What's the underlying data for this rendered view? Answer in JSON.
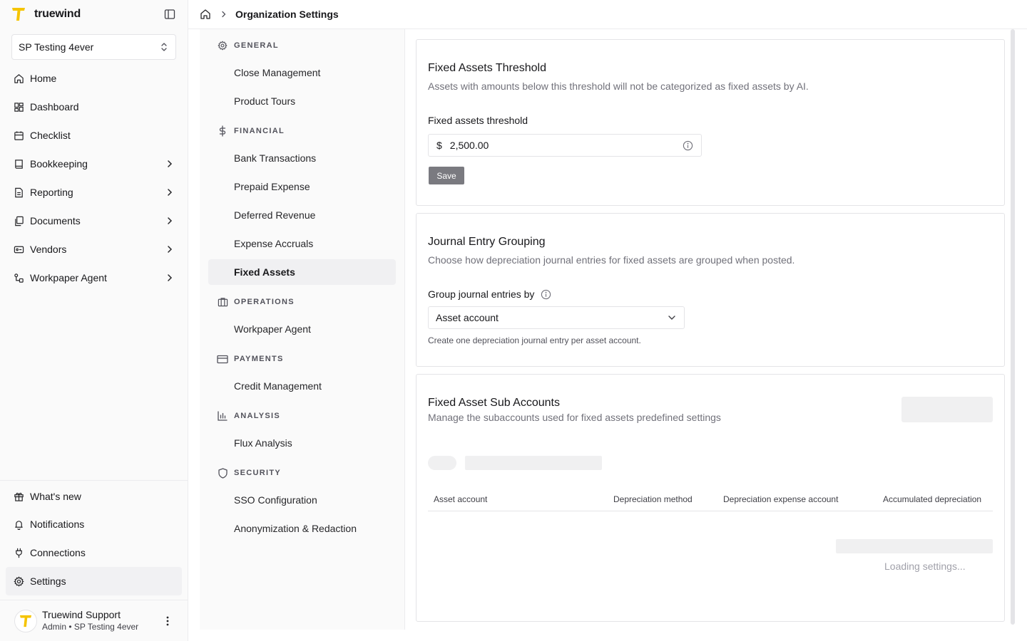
{
  "app": {
    "name": "truewind"
  },
  "org_switcher": {
    "name": "SP Testing 4ever"
  },
  "sidebar": {
    "items": [
      {
        "label": "Home",
        "icon": "home-icon"
      },
      {
        "label": "Dashboard",
        "icon": "dashboard-icon"
      },
      {
        "label": "Checklist",
        "icon": "calendar-icon"
      },
      {
        "label": "Bookkeeping",
        "icon": "book-icon",
        "has_children": true
      },
      {
        "label": "Reporting",
        "icon": "file-text-icon",
        "has_children": true
      },
      {
        "label": "Documents",
        "icon": "documents-icon",
        "has_children": true
      },
      {
        "label": "Vendors",
        "icon": "vendor-card-icon",
        "has_children": true
      },
      {
        "label": "Workpaper Agent",
        "icon": "agent-icon",
        "has_children": true
      }
    ],
    "bottom": [
      {
        "label": "What's new",
        "icon": "gift-icon"
      },
      {
        "label": "Notifications",
        "icon": "bell-icon"
      },
      {
        "label": "Connections",
        "icon": "plug-icon"
      },
      {
        "label": "Settings",
        "icon": "gear-icon",
        "active": true
      }
    ]
  },
  "user": {
    "name": "Truewind Support",
    "role": "Admin • SP Testing 4ever"
  },
  "breadcrumb": {
    "current": "Organization Settings"
  },
  "settings_nav": {
    "general": {
      "label": "GENERAL",
      "items": [
        "Close Management",
        "Product Tours"
      ]
    },
    "financial": {
      "label": "FINANCIAL",
      "items": [
        "Bank Transactions",
        "Prepaid Expense",
        "Deferred Revenue",
        "Expense Accruals",
        "Fixed Assets"
      ]
    },
    "operations": {
      "label": "OPERATIONS",
      "items": [
        "Workpaper Agent"
      ]
    },
    "payments": {
      "label": "PAYMENTS",
      "items": [
        "Credit Management"
      ]
    },
    "analysis": {
      "label": "ANALYSIS",
      "items": [
        "Flux Analysis"
      ]
    },
    "security": {
      "label": "SECURITY",
      "items": [
        "SSO Configuration",
        "Anonymization & Redaction"
      ]
    },
    "active_item": "Fixed Assets"
  },
  "threshold_card": {
    "title": "Fixed Assets Threshold",
    "description": "Assets with amounts below this threshold will not be categorized as fixed assets by AI.",
    "field_label": "Fixed assets threshold",
    "currency": "$",
    "value": "2,500.00",
    "save_label": "Save"
  },
  "grouping_card": {
    "title": "Journal Entry Grouping",
    "description": "Choose how depreciation journal entries for fixed assets are grouped when posted.",
    "field_label": "Group journal entries by",
    "selected": "Asset account",
    "helper": "Create one depreciation journal entry per asset account."
  },
  "subaccounts_card": {
    "title": "Fixed Asset Sub Accounts",
    "description": "Manage the subaccounts used for fixed assets predefined settings",
    "columns": [
      "Asset account",
      "Depreciation method",
      "Depreciation expense account",
      "Accumulated depreciation"
    ],
    "loading_text": "Loading settings..."
  },
  "colors": {
    "brand_yellow": "#f5c400",
    "save_button": "#7a7a80",
    "skeleton": "#f0f0f1"
  }
}
